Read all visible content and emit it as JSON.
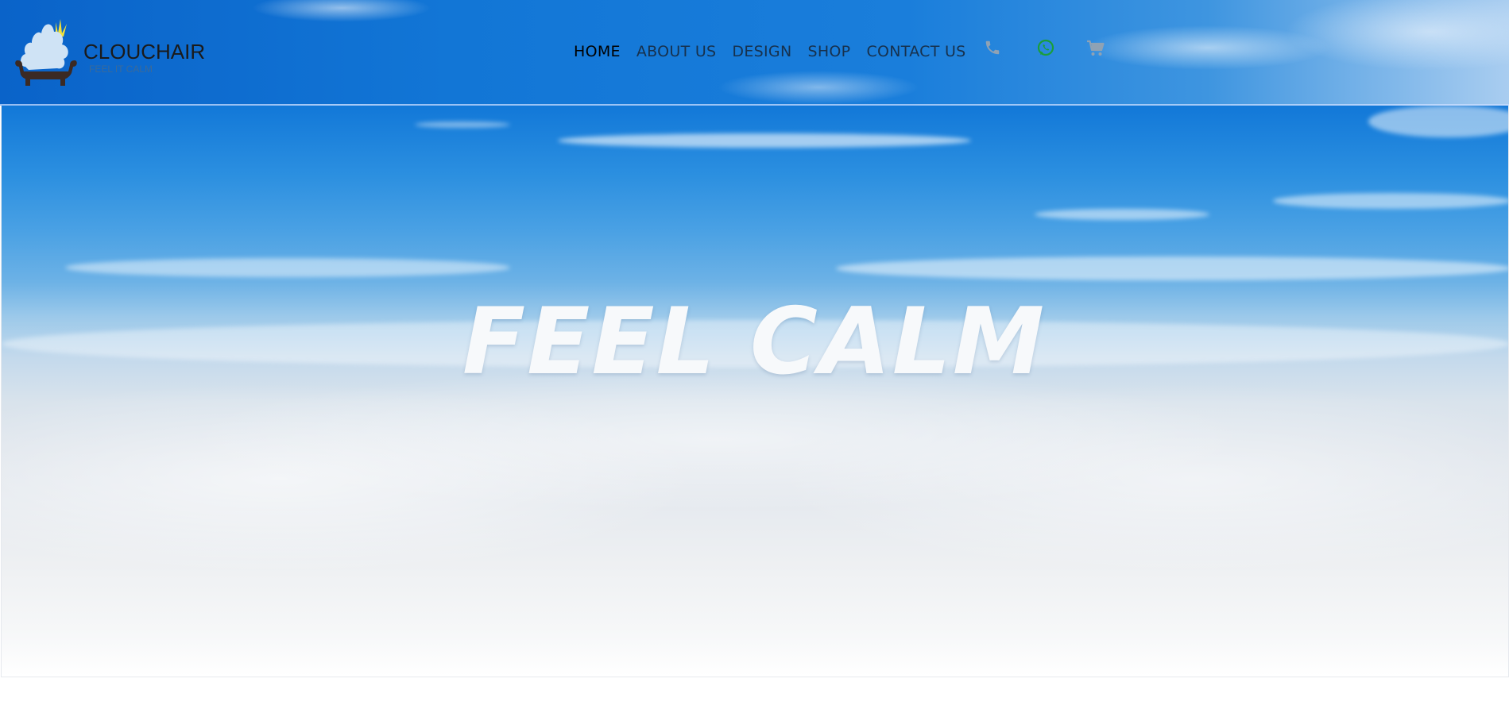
{
  "brand": {
    "name": "CLOUCHAIR",
    "tagline": "FEEL IT CALM"
  },
  "nav": {
    "items": [
      {
        "label": "HOME",
        "active": true
      },
      {
        "label": "ABOUT US",
        "active": false
      },
      {
        "label": "DESIGN",
        "active": false
      },
      {
        "label": "SHOP",
        "active": false
      },
      {
        "label": "CONTACT US",
        "active": false
      }
    ],
    "icons": [
      "phone-icon",
      "whatsapp-icon",
      "cart-icon"
    ]
  },
  "hero": {
    "title": "FEEL CALM"
  },
  "colors": {
    "sky_blue": "#1276d6",
    "whatsapp_green": "#1a9e3a",
    "icon_gray": "#8a9db0",
    "logo_chair": "#3b2a24",
    "logo_cloud": "#cfe3f5",
    "logo_crown": "#f2e23a"
  }
}
